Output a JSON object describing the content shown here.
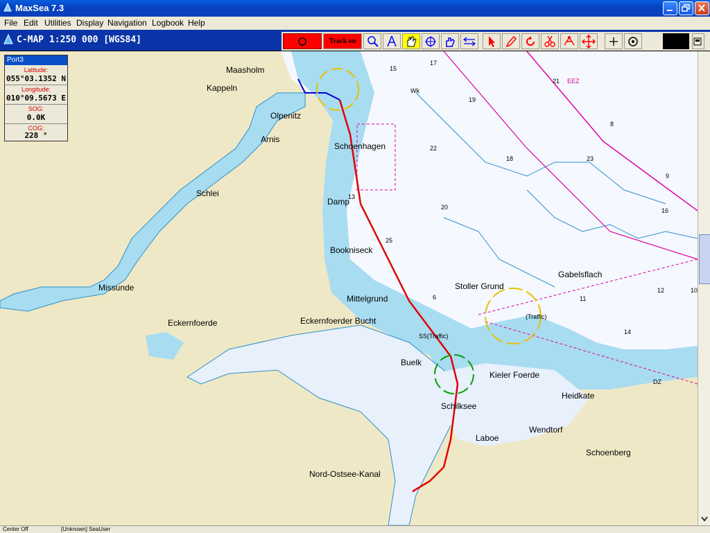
{
  "app": {
    "title": "MaxSea 7.3"
  },
  "menu": [
    "File",
    "Edit",
    "Utilities",
    "Display",
    "Navigation",
    "Logbook",
    "Help"
  ],
  "chart_header": {
    "title": "C-MAP  1:250 000 [WGS84]"
  },
  "toolbar": {
    "track_label": "Track on"
  },
  "gps_panel": {
    "title": "Port3",
    "fields": [
      {
        "label": "Latitude:",
        "value": "055°03.1352 N"
      },
      {
        "label": "Longitude:",
        "value": "010°09.5673 E"
      },
      {
        "label": "SOG:",
        "value": "0.0K"
      },
      {
        "label": "COG:",
        "value": "228 °"
      }
    ]
  },
  "places": [
    "Maasholm",
    "Kappeln",
    "Olpenitz",
    "Arnis",
    "Schoenhagen",
    "Schlei",
    "Damp",
    "Bookniseck",
    "Missunde",
    "Eckernfoerde",
    "Mittelgrund",
    "Eckernfoerder Bucht",
    "Stoller Grund",
    "Gabelsflach",
    "Buelk",
    "Kieler Foerde",
    "Heidkate",
    "Schilksee",
    "Laboe",
    "Wendtorf",
    "Schoenberg",
    "Nord-Ostsee-Kanal"
  ],
  "soundings": [
    "15",
    "17",
    "22",
    "21",
    "20",
    "19",
    "18",
    "16",
    "13",
    "12",
    "10",
    "14",
    "11",
    "25",
    "6",
    "8",
    "9",
    "23"
  ],
  "chart_annotations": {
    "traffic": "SS(Traffic)",
    "traffic2": "(Traffic)",
    "wk": "Wk",
    "dz": "DZ",
    "eez": "EEZ"
  },
  "status": {
    "left": "Center Off",
    "middle": "[Unknown] SeaUser"
  }
}
